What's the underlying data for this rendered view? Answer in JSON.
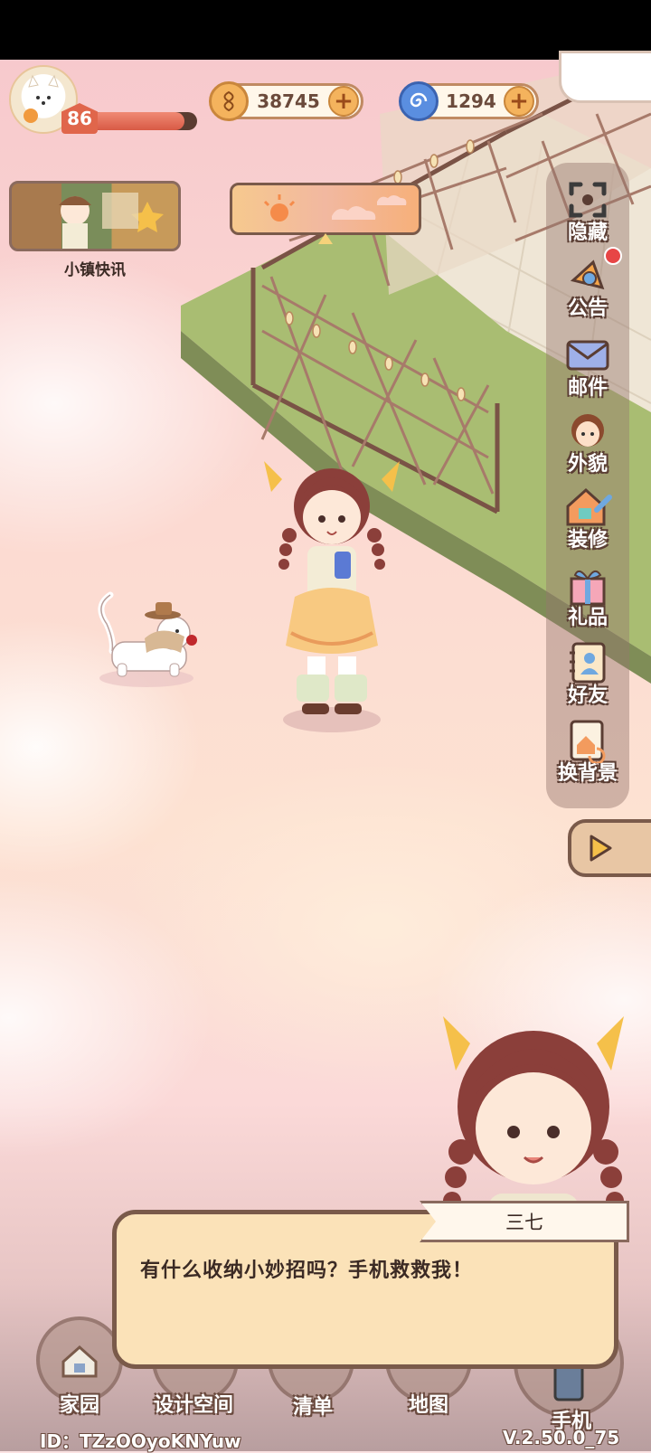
{
  "player": {
    "level": "86",
    "xp_fraction": 0.88
  },
  "currencies": [
    {
      "name": "coins",
      "icon": "leaf-coin-icon",
      "value": "38745",
      "add": "+"
    },
    {
      "name": "gems",
      "icon": "blue-swirl-icon",
      "value": "1294",
      "add": "+"
    }
  ],
  "news": {
    "label": "小镇快讯"
  },
  "side_menu": [
    {
      "id": "hide",
      "icon": "hide-icon",
      "label": "隐藏"
    },
    {
      "id": "notice",
      "icon": "announcement-icon",
      "label": "公告"
    },
    {
      "id": "mail",
      "icon": "mail-icon",
      "label": "邮件"
    },
    {
      "id": "appearance",
      "icon": "appearance-icon",
      "label": "外貌"
    },
    {
      "id": "decorate",
      "icon": "decorate-icon",
      "label": "装修"
    },
    {
      "id": "gift",
      "icon": "gift-icon",
      "label": "礼品"
    },
    {
      "id": "friends",
      "icon": "friends-icon",
      "label": "好友"
    },
    {
      "id": "background",
      "icon": "change-background-icon",
      "label": "换背景"
    }
  ],
  "dialog": {
    "speaker": "三七",
    "text": "有什么收纳小妙招吗？手机救救我！"
  },
  "bottom_nav": [
    {
      "id": "home",
      "icon": "house-icon",
      "label": "家园"
    },
    {
      "id": "design",
      "icon": "design-icon",
      "label": "设计空间"
    },
    {
      "id": "list",
      "icon": "list-icon",
      "label": "清单"
    },
    {
      "id": "map",
      "icon": "map-icon",
      "label": "地图"
    },
    {
      "id": "phone",
      "icon": "phone-icon",
      "label": "手机"
    }
  ],
  "footer": {
    "id": "ID：TZzOOyoKNYuw",
    "version": "V.2.50.0_75"
  },
  "colors": {
    "accent": "#e0664b",
    "panel": "#fbe2b8",
    "border": "#7a5a4a"
  }
}
